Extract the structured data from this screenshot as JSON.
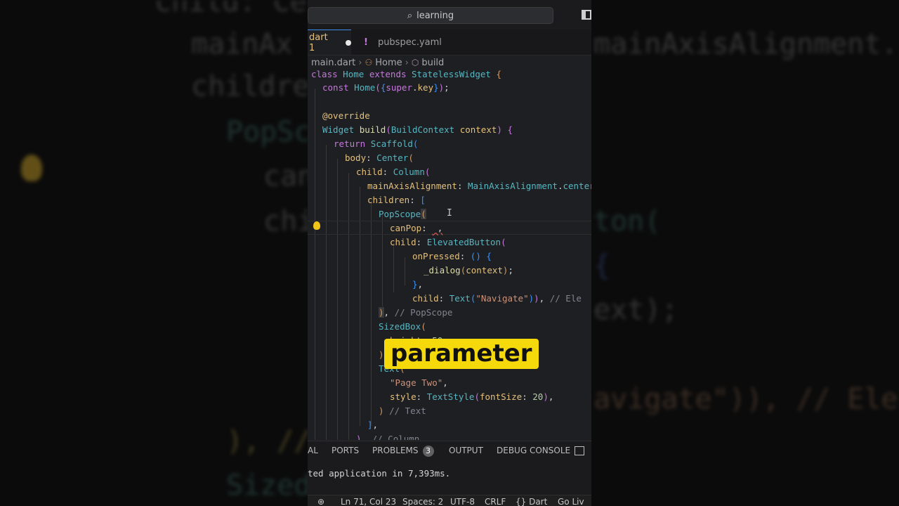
{
  "search": {
    "label": "learning"
  },
  "tabs": [
    {
      "label": "dart 1"
    },
    {
      "label": "pubspec.yaml"
    }
  ],
  "breadcrumb": [
    "main.dart",
    "Home",
    "build"
  ],
  "code_lines": [
    "class Home extends StatelessWidget {",
    "const Home({super.key});",
    "",
    "@override",
    "Widget build(BuildContext context) {",
    "return Scaffold(",
    "body: Center(",
    "child: Column(",
    "mainAxisAlignment: MainAxisAlignment.center,",
    "children: [",
    "PopScope(",
    "canPop: ,",
    "child: ElevatedButton(",
    "onPressed: () {",
    "_dialog(context);",
    "},",
    "child: Text(\"Navigate\")), // Ele",
    "), // PopScope",
    "SizedBox(",
    "height: 50,",
    "),",
    "Text(",
    "\"Page Two\",",
    "style: TextStyle(fontSize: 20),",
    ") // Text",
    "],",
    "), // Column"
  ],
  "caption": "parameter",
  "panel_tabs": {
    "terminal": "AL",
    "ports": "PORTS",
    "problems": "PROBLEMS",
    "problems_count": "3",
    "output": "OUTPUT",
    "debug_console": "DEBUG CONSOLE"
  },
  "terminal_text": "ted application in 7,393ms.",
  "status": {
    "position": "Ln 71, Col 23",
    "spaces": "Spaces: 2",
    "encoding": "UTF-8",
    "eol": "CRLF",
    "language": "{} Dart",
    "golive": "Go Liv"
  },
  "background_text": [
    "child: Ce",
    "mainAxisAlignment.cen",
    "childre",
    "PopSco",
    "can",
    "chi",
    "ton(",
    "{",
    "ext);",
    "avigate\")), // Ele",
    "), //",
    "Sized"
  ]
}
